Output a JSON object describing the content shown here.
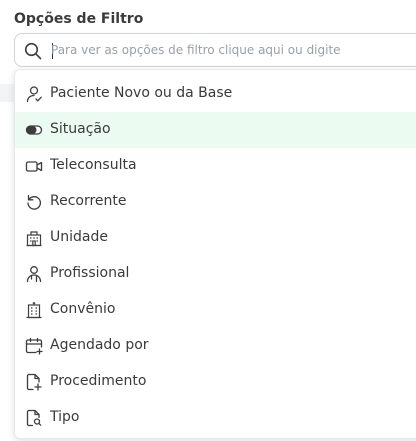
{
  "filter": {
    "title": "Opções de Filtro",
    "search_placeholder": "Para ver as opções de filtro clique aqui ou digite",
    "search_value": ""
  },
  "menu": {
    "items": [
      {
        "label": "Paciente Novo ou da Base",
        "icon": "user-check-icon"
      },
      {
        "label": "Situação",
        "icon": "toggle-icon",
        "active": true
      },
      {
        "label": "Teleconsulta",
        "icon": "video-camera-icon"
      },
      {
        "label": "Recorrente",
        "icon": "rotate-ccw-icon"
      },
      {
        "label": "Unidade",
        "icon": "building-icon"
      },
      {
        "label": "Profissional",
        "icon": "user-badge-icon"
      },
      {
        "label": "Convênio",
        "icon": "hospital-icon"
      },
      {
        "label": "Agendado por",
        "icon": "calendar-plus-icon"
      },
      {
        "label": "Procedimento",
        "icon": "file-plus-icon"
      },
      {
        "label": "Tipo",
        "icon": "file-search-icon"
      }
    ]
  },
  "colors": {
    "active_bg": "#ecfbf1",
    "background_accent": "#2e7d4f"
  }
}
